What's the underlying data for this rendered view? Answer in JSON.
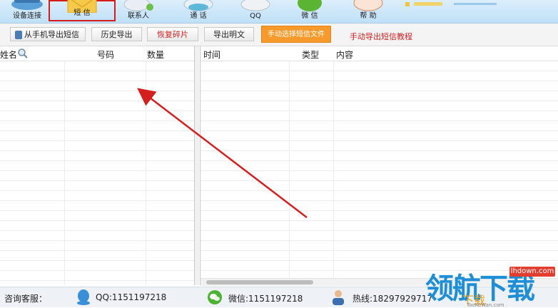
{
  "nav": {
    "items": [
      {
        "label": "设备连接",
        "icon": "device-connect-icon"
      },
      {
        "label": "短 信",
        "icon": "envelope-icon",
        "selected": true
      },
      {
        "label": "联系人",
        "icon": "contacts-icon"
      },
      {
        "label": "通 话",
        "icon": "phone-icon"
      },
      {
        "label": "QQ",
        "icon": "qq-icon"
      },
      {
        "label": "微 信",
        "icon": "wechat-icon"
      },
      {
        "label": "帮 助",
        "icon": "help-icon"
      }
    ]
  },
  "toolbar": {
    "export_from_phone": "从手机导出短信",
    "history_export": "历史导出",
    "restore_fragments": "恢复碎片",
    "export_plaintext": "导出明文",
    "manual_select_file": "手动选择短信文件",
    "manual_export_tutorial": "手动导出短信教程"
  },
  "left_table": {
    "columns": [
      "姓名",
      "号码",
      "数量"
    ],
    "rows": []
  },
  "right_table": {
    "columns": [
      "时间",
      "类型",
      "内容"
    ],
    "rows": []
  },
  "status": {
    "consult_label": "咨询客服：",
    "qq": "QQ:1151197218",
    "wechat": "微信:1151197218",
    "hotline": "热线:18297929717"
  },
  "watermark": {
    "main": "领航下载",
    "badge": "lhdown.com",
    "sub": "下载",
    "url": "TooKeWan.com"
  },
  "colors": {
    "accent_red": "#d61b1b",
    "orange_button": "#f59a2b",
    "nav_bg": "#cfe7f9"
  }
}
